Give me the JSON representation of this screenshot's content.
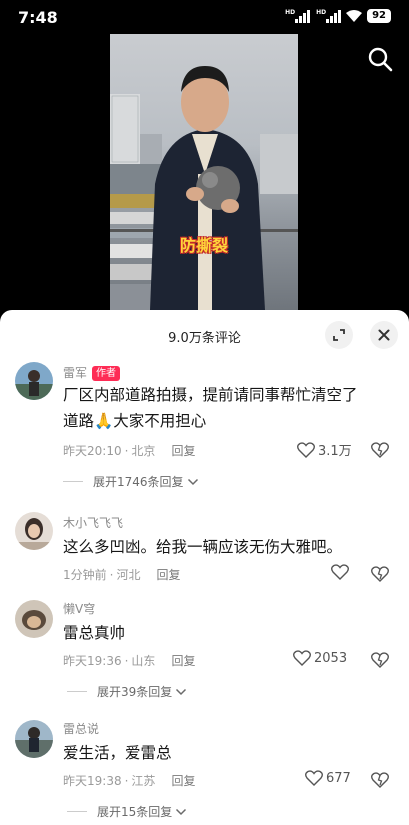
{
  "status_bar": {
    "time": "7:48",
    "network_label": "HD",
    "battery": "92"
  },
  "video": {
    "caption": "防撕裂"
  },
  "comments_panel": {
    "title": "9.0万条评论",
    "comments": [
      {
        "author": "雷军",
        "author_tag": "作者",
        "text": "厂区内部道路拍摄，提前请同事帮忙清空了道路🙏大家不用担心",
        "time": "昨天20:10",
        "location": "北京",
        "reply_label": "回复",
        "likes": "3.1万",
        "expand_replies": "展开1746条回复"
      },
      {
        "author": "木小飞飞飞",
        "text": "这么多凹凼。给我一辆应该无伤大雅吧。",
        "time": "1分钟前",
        "location": "河北",
        "reply_label": "回复",
        "likes": ""
      },
      {
        "author": "懒V穹",
        "text": "雷总真帅",
        "time": "昨天19:36",
        "location": "山东",
        "reply_label": "回复",
        "likes": "2053",
        "expand_replies": "展开39条回复"
      },
      {
        "author": "雷总说",
        "text": "爱生活，爱雷总",
        "time": "昨天19:38",
        "location": "江苏",
        "reply_label": "回复",
        "likes": "677",
        "expand_replies": "展开15条回复"
      }
    ]
  },
  "colors": {
    "author_tag": "#fe2c55",
    "caption": "#ffd43b"
  },
  "icons": [
    "search-icon",
    "expand-icon",
    "close-icon",
    "heart-icon",
    "dislike-icon",
    "chevron-down-icon"
  ]
}
